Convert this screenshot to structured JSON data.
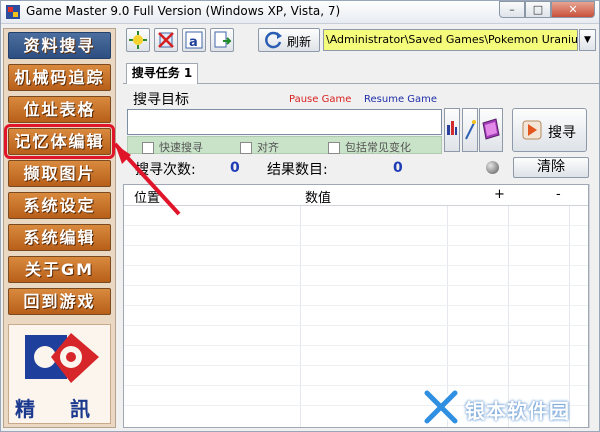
{
  "window": {
    "title": "Game Master 9.0 Full Version (Windows XP, Vista, 7)",
    "min_label": "–",
    "max_label": "□",
    "close_label": "✕"
  },
  "sidebar": {
    "items": [
      {
        "label": "资料搜寻",
        "kind": "search"
      },
      {
        "label": "机械码追踪"
      },
      {
        "label": "位址表格"
      },
      {
        "label": "记忆体编辑",
        "active": true
      },
      {
        "label": "撷取图片"
      },
      {
        "label": "系统设定"
      },
      {
        "label": "系统编辑"
      },
      {
        "label": "关于GM"
      },
      {
        "label": "回到游戏"
      }
    ],
    "logo_text": "精 訊"
  },
  "toolbar": {
    "refresh_label": "刷新",
    "path": "\\Administrator\\Saved Games\\Pokemon Uranium\\Urani"
  },
  "tabs": [
    {
      "label": "搜寻任务 1",
      "selected": true
    }
  ],
  "search_panel": {
    "target_label": "搜寻目标",
    "pause_link": "Pause Game",
    "resume_link": "Resume Game",
    "search_value": "",
    "options": [
      {
        "label": "快速搜寻",
        "checked": false
      },
      {
        "label": "对齐",
        "checked": false
      },
      {
        "label": "包括常见变化",
        "checked": false
      }
    ],
    "search_button": "搜寻",
    "search_count_label": "搜寻次数:",
    "search_count": "0",
    "result_count_label": "结果数目:",
    "result_count": "0",
    "clear_button": "清除"
  },
  "table": {
    "columns": [
      "位置",
      "数值",
      "+",
      "-"
    ],
    "rows": []
  },
  "watermark": {
    "text": "银本软件园"
  },
  "colors": {
    "nav_orange": "#c8702a",
    "nav_blue": "#3a5d92",
    "highlight_red": "#e0152a",
    "path_yellow": "#f5fb7a",
    "options_green": "#c9e3c9",
    "count_blue": "#1e3cb4"
  }
}
